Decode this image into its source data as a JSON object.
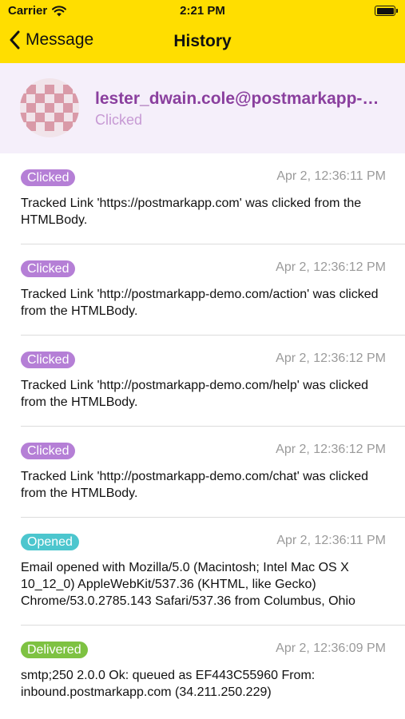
{
  "status_bar": {
    "carrier": "Carrier",
    "time": "2:21 PM"
  },
  "nav": {
    "back_label": "Message",
    "title": "History"
  },
  "recipient": {
    "email": "lester_dwain.cole@postmarkapp-demo.com",
    "status": "Clicked"
  },
  "colors": {
    "nav_bg": "#ffde00",
    "clicked": "#b57fd6",
    "opened": "#4cc6ce",
    "delivered": "#7ec242",
    "accent_text": "#8a3f9e"
  },
  "events": [
    {
      "badge": "Clicked",
      "kind": "clicked",
      "timestamp": "Apr 2, 12:36:11 PM",
      "message": "Tracked Link 'https://postmarkapp.com' was clicked from the HTMLBody."
    },
    {
      "badge": "Clicked",
      "kind": "clicked",
      "timestamp": "Apr 2, 12:36:12 PM",
      "message": "Tracked Link 'http://postmarkapp-demo.com/action' was clicked from the HTMLBody."
    },
    {
      "badge": "Clicked",
      "kind": "clicked",
      "timestamp": "Apr 2, 12:36:12 PM",
      "message": "Tracked Link 'http://postmarkapp-demo.com/help' was clicked from the HTMLBody."
    },
    {
      "badge": "Clicked",
      "kind": "clicked",
      "timestamp": "Apr 2, 12:36:12 PM",
      "message": "Tracked Link 'http://postmarkapp-demo.com/chat' was clicked from the HTMLBody."
    },
    {
      "badge": "Opened",
      "kind": "opened",
      "timestamp": "Apr 2, 12:36:11 PM",
      "message": "Email opened with Mozilla/5.0 (Macintosh; Intel Mac OS X 10_12_0) AppleWebKit/537.36 (KHTML, like Gecko) Chrome/53.0.2785.143 Safari/537.36 from Columbus, Ohio"
    },
    {
      "badge": "Delivered",
      "kind": "delivered",
      "timestamp": "Apr 2, 12:36:09 PM",
      "message": "smtp;250 2.0.0 Ok: queued as EF443C55960 From: inbound.postmarkapp.com (34.211.250.229)"
    }
  ]
}
